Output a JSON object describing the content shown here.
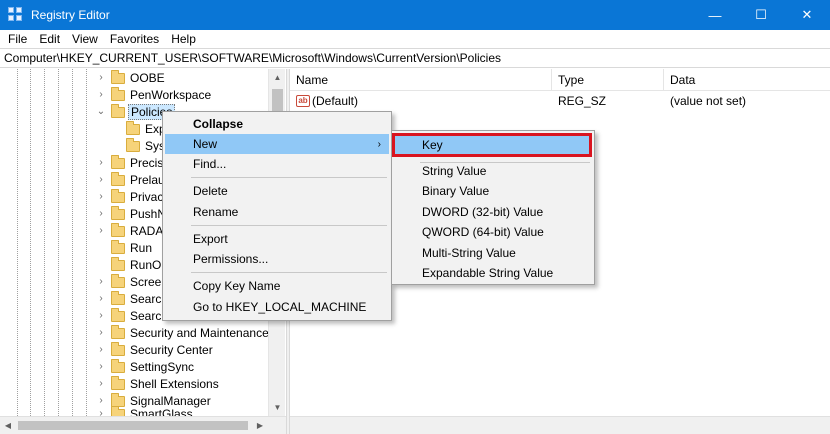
{
  "window": {
    "title": "Registry Editor",
    "minimize": "—",
    "maximize": "☐",
    "close": "✕"
  },
  "menu": [
    "File",
    "Edit",
    "View",
    "Favorites",
    "Help"
  ],
  "address": "Computer\\HKEY_CURRENT_USER\\SOFTWARE\\Microsoft\\Windows\\CurrentVersion\\Policies",
  "tree": {
    "items": [
      {
        "label": "OOBE",
        "chevron": "›"
      },
      {
        "label": "PenWorkspace",
        "chevron": "›"
      },
      {
        "label": "Policies",
        "chevron": "⌄"
      },
      {
        "label": "Exp",
        "chevron": ""
      },
      {
        "label": "Sys",
        "chevron": ""
      },
      {
        "label": "Precis",
        "chevron": "›"
      },
      {
        "label": "Prelau",
        "chevron": "›"
      },
      {
        "label": "Privac",
        "chevron": "›"
      },
      {
        "label": "PushN",
        "chevron": "›"
      },
      {
        "label": "RADA",
        "chevron": "›"
      },
      {
        "label": "Run",
        "chevron": ""
      },
      {
        "label": "RunOr",
        "chevron": ""
      },
      {
        "label": "Screer",
        "chevron": "›"
      },
      {
        "label": "Search",
        "chevron": "›"
      },
      {
        "label": "Search",
        "chevron": "›"
      },
      {
        "label": "Security and Maintenance",
        "chevron": "›"
      },
      {
        "label": "Security Center",
        "chevron": "›"
      },
      {
        "label": "SettingSync",
        "chevron": "›"
      },
      {
        "label": "Shell Extensions",
        "chevron": "›"
      },
      {
        "label": "SignalManager",
        "chevron": "›"
      },
      {
        "label": "SmartGlass",
        "chevron": "›"
      }
    ]
  },
  "list": {
    "columns": [
      "Name",
      "Type",
      "Data"
    ],
    "rows": [
      {
        "icon": "ab",
        "name": "(Default)",
        "type": "REG_SZ",
        "data": "(value not set)"
      }
    ]
  },
  "context_menu": {
    "collapse": "Collapse",
    "new": "New",
    "new_arrow": "›",
    "find": "Find...",
    "delete": "Delete",
    "rename": "Rename",
    "export": "Export",
    "permissions": "Permissions...",
    "copy_key_name": "Copy Key Name",
    "goto": "Go to HKEY_LOCAL_MACHINE"
  },
  "submenu": {
    "key": "Key",
    "string_value": "String Value",
    "binary_value": "Binary Value",
    "dword_value": "DWORD (32-bit) Value",
    "qword_value": "QWORD (64-bit) Value",
    "multi_string_value": "Multi-String Value",
    "expandable_string_value": "Expandable String Value"
  },
  "colors": {
    "titlebar": "#0a76d6",
    "highlight": "#90c8f6",
    "key_outline": "#d9141f"
  }
}
